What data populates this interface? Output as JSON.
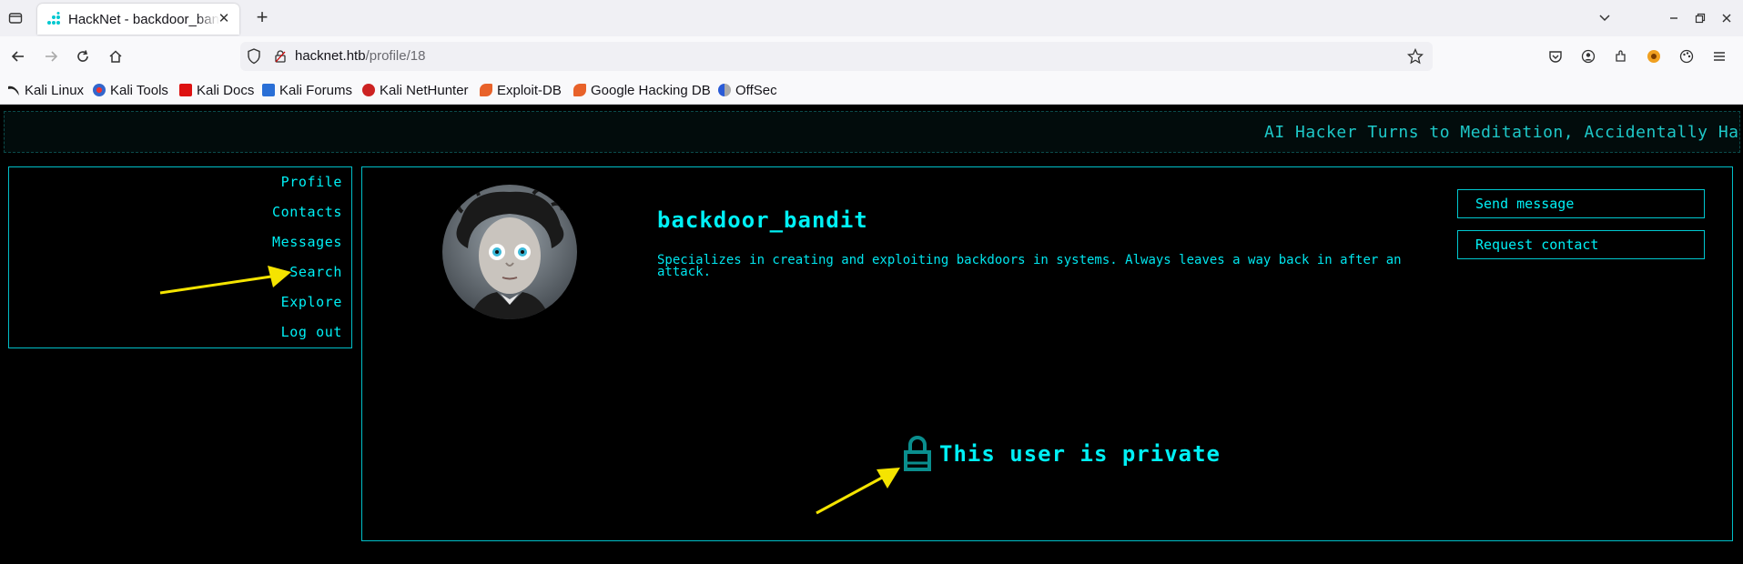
{
  "browser": {
    "tab_title": "HackNet - backdoor_bandit",
    "url_host": "hacknet.htb",
    "url_path": "/profile/18",
    "bookmarks": [
      "Kali Linux",
      "Kali Tools",
      "Kali Docs",
      "Kali Forums",
      "Kali NetHunter",
      "Exploit-DB",
      "Google Hacking DB",
      "OffSec"
    ]
  },
  "ticker": {
    "text": "AI Hacker Turns to Meditation, Accidentally Hacks"
  },
  "sidebar": {
    "items": [
      {
        "label": "Profile"
      },
      {
        "label": "Contacts"
      },
      {
        "label": "Messages"
      },
      {
        "label": "Search"
      },
      {
        "label": "Explore"
      },
      {
        "label": "Log out"
      }
    ]
  },
  "profile": {
    "username": "backdoor_bandit",
    "bio": "Specializes in creating and exploiting backdoors in systems. Always leaves a way back in after an attack.",
    "send_message_label": "Send message",
    "request_contact_label": "Request contact",
    "private_notice": "This user is private"
  },
  "colors": {
    "accent": "#00f0f5",
    "border": "#00bfc8",
    "annotation": "#f5e400"
  }
}
